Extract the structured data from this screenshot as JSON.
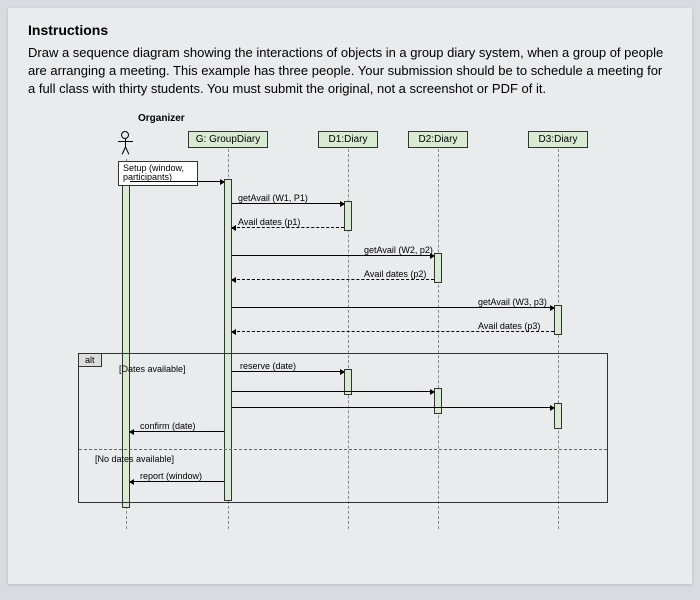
{
  "heading": "Instructions",
  "body": "Draw a sequence diagram showing the interactions of objects in a group diary system, when a group of people are arranging a meeting.  This example has three people.  Your submission should be to schedule a meeting for a full class with thirty students.  You must submit the original, not a screenshot or PDF of it.",
  "diagram": {
    "actor": "Organizer",
    "participants": {
      "g": "G: GroupDiary",
      "d1": "D1:Diary",
      "d2": "D2:Diary",
      "d3": "D3:Diary"
    },
    "setup_note": "Setup (window, participants)",
    "messages": {
      "getAvail1": "getAvail (W1, P1)",
      "avail1": "Avail dates (p1)",
      "getAvail2": "getAvail (W2, p2)",
      "avail2": "Avail dates (p2)",
      "getAvail3": "getAvail (W3, p3)",
      "avail3": "Avail dates (p3)",
      "reserve": "reserve (date)",
      "confirm": "confirm (date)",
      "report": "report (window)"
    },
    "alt": {
      "tag": "alt",
      "guard1": "[Dates available]",
      "guard2": "[No dates available]"
    }
  }
}
